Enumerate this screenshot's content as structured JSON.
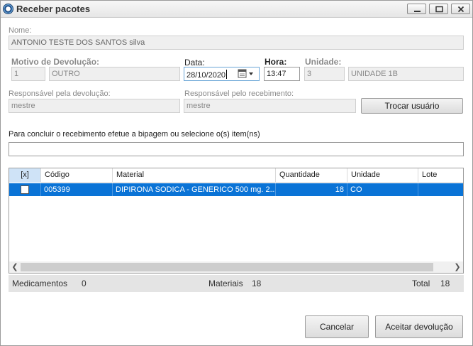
{
  "window": {
    "title": "Receber pacotes"
  },
  "form": {
    "nome": {
      "label": "Nome:",
      "value": "ANTONIO TESTE DOS SANTOS silva"
    },
    "motivo": {
      "label": "Motivo de Devolução:",
      "code": "1",
      "text": "OUTRO"
    },
    "data": {
      "label": "Data:",
      "value": "28/10/2020"
    },
    "hora": {
      "label": "Hora:",
      "value": "13:47"
    },
    "unidade": {
      "label": "Unidade:",
      "code": "3",
      "text": "UNIDADE 1B"
    },
    "responsavel_devolucao": {
      "label": "Responsável pela devolução:",
      "value": "mestre"
    },
    "responsavel_recebimento": {
      "label": "Responsável pelo recebimento:",
      "value": "mestre"
    },
    "trocar_usuario_label": "Trocar usuário",
    "instruction": "Para concluir o recebimento efetue a bipagem ou selecione o(s) item(ns)",
    "scan_value": ""
  },
  "grid": {
    "columns": [
      "[x]",
      "Código",
      "Material",
      "Quantidade",
      "Unidade",
      "Lote"
    ],
    "rows": [
      {
        "codigo": "005399",
        "material": "DIPIRONA SODICA - GENERICO 500 mg. 2...",
        "quantidade": "18",
        "unidade": "CO",
        "lote": ""
      }
    ]
  },
  "summary": {
    "medicamentos_label": "Medicamentos",
    "medicamentos_value": "0",
    "materiais_label": "Materiais",
    "materiais_value": "18",
    "total_label": "Total",
    "total_value": "18"
  },
  "buttons": {
    "cancel": "Cancelar",
    "accept": "Aceitar devolução"
  },
  "icons": {
    "app": "app-logo-icon",
    "minimize": "minimize-icon",
    "maximize": "maximize-icon",
    "close": "close-icon",
    "calendar": "calendar-icon",
    "dropdown": "chevron-down-icon"
  },
  "colors": {
    "selection": "#0a73d6",
    "header_selected": "#cfe3f7"
  }
}
